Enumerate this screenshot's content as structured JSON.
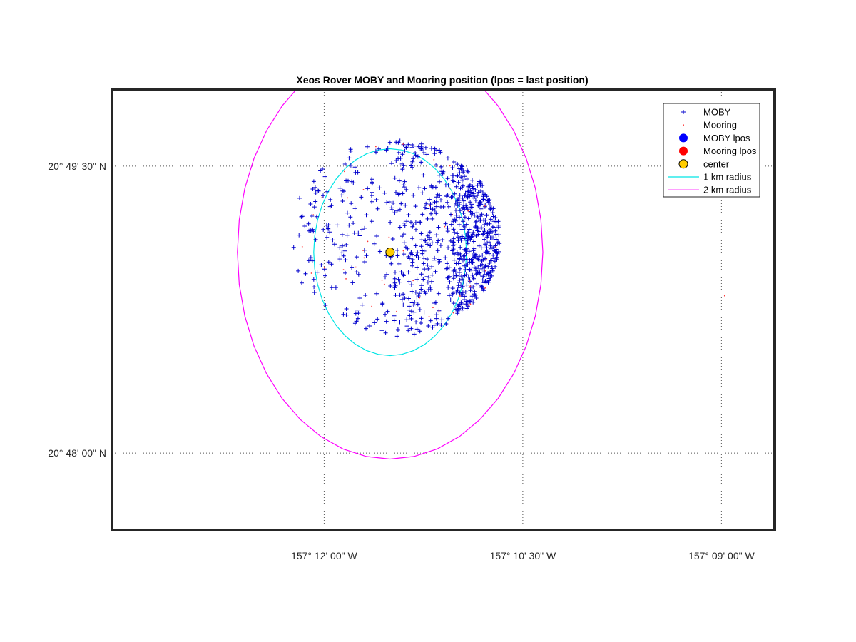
{
  "chart_data": {
    "type": "scatter",
    "title": "Xeos Rover MOBY and Mooring position (lpos = last position)",
    "x_axis": {
      "unit": "longitude (deg)",
      "range": [
        -157.2267,
        -157.1433
      ],
      "ticks": [
        {
          "value": -157.2,
          "label": "157° 12' 00\" W"
        },
        {
          "value": -157.175,
          "label": "157° 10' 30\" W"
        },
        {
          "value": -157.15,
          "label": "157° 09' 00\" W"
        }
      ]
    },
    "y_axis": {
      "unit": "latitude (deg)",
      "range": [
        20.7933,
        20.8317
      ],
      "ticks": [
        {
          "value": 20.825,
          "label": "20° 49' 30\" N"
        },
        {
          "value": 20.8,
          "label": "20° 48' 00\" N"
        }
      ]
    },
    "grid": true,
    "legend_position": "top-right",
    "center": [
      -157.1917,
      20.8175
    ],
    "last_positions": {
      "moby": [
        -157.1917,
        20.8175
      ],
      "mooring": [
        -157.1917,
        20.8175
      ]
    },
    "stray_mooring_point": [
      -157.1496,
      20.8137
    ],
    "point_cloud": {
      "moby_count": 900,
      "mooring_count": 45,
      "radius_deg_lat": 0.0095,
      "dense_side": "east"
    },
    "series": [
      {
        "name": "MOBY",
        "marker": "+",
        "color": "#0000cc"
      },
      {
        "name": "Mooring",
        "marker": ".",
        "color": "#ff3333"
      },
      {
        "name": "MOBY lpos",
        "marker": "circle",
        "color": "#0000ff"
      },
      {
        "name": "Mooring lpos",
        "marker": "circle",
        "color": "#ff0000"
      },
      {
        "name": "center",
        "marker": "circle",
        "color": "#ffcc00"
      },
      {
        "name": "1 km radius",
        "marker": "line",
        "color": "#00e5e5",
        "radius_km": 1
      },
      {
        "name": "2 km radius",
        "marker": "line",
        "color": "#ff00ff",
        "radius_km": 2
      }
    ]
  }
}
